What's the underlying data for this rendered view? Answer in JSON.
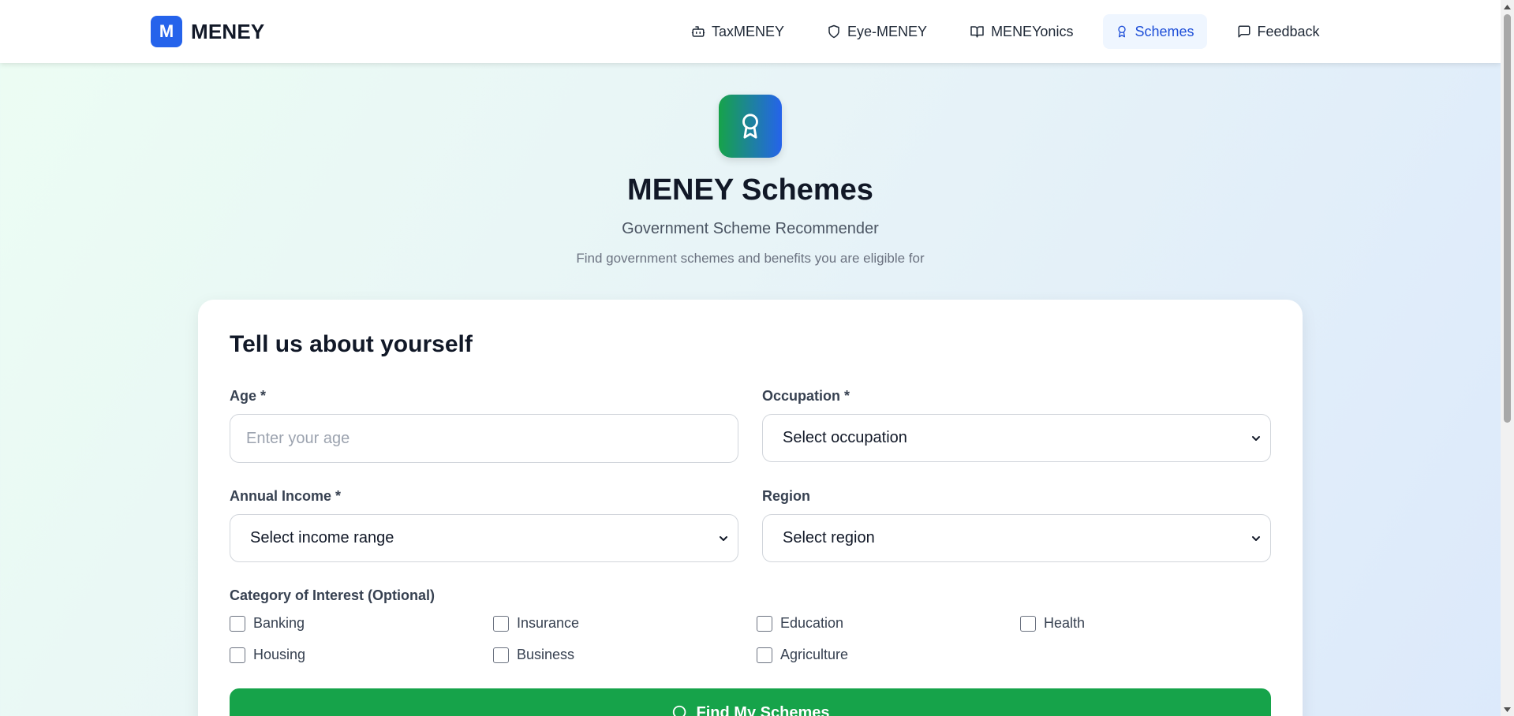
{
  "brand": {
    "badge": "M",
    "name": "MENEY"
  },
  "nav": {
    "items": [
      {
        "label": "TaxMENEY",
        "icon": "robot-icon"
      },
      {
        "label": "Eye-MENEY",
        "icon": "shield-icon"
      },
      {
        "label": "MENEYonics",
        "icon": "book-open-icon"
      },
      {
        "label": "Schemes",
        "icon": "award-icon",
        "active": true
      },
      {
        "label": "Feedback",
        "icon": "message-square-icon"
      }
    ]
  },
  "hero": {
    "icon": "award-icon",
    "title": "MENEY Schemes",
    "subtitle": "Government Scheme Recommender",
    "description": "Find government schemes and benefits you are eligible for"
  },
  "form": {
    "title": "Tell us about yourself",
    "age": {
      "label": "Age *",
      "placeholder": "Enter your age",
      "value": ""
    },
    "occupation": {
      "label": "Occupation *",
      "selected": "Select occupation"
    },
    "income": {
      "label": "Annual Income *",
      "selected": "Select income range"
    },
    "region": {
      "label": "Region",
      "selected": "Select region"
    },
    "categories": {
      "label": "Category of Interest (Optional)",
      "options": [
        "Banking",
        "Insurance",
        "Education",
        "Health",
        "Housing",
        "Business",
        "Agriculture"
      ],
      "checked": []
    },
    "submit_label": "Find My Schemes"
  },
  "colors": {
    "brand_blue": "#2563eb",
    "active_nav_bg": "#eff6ff",
    "primary_green": "#16a34a"
  }
}
